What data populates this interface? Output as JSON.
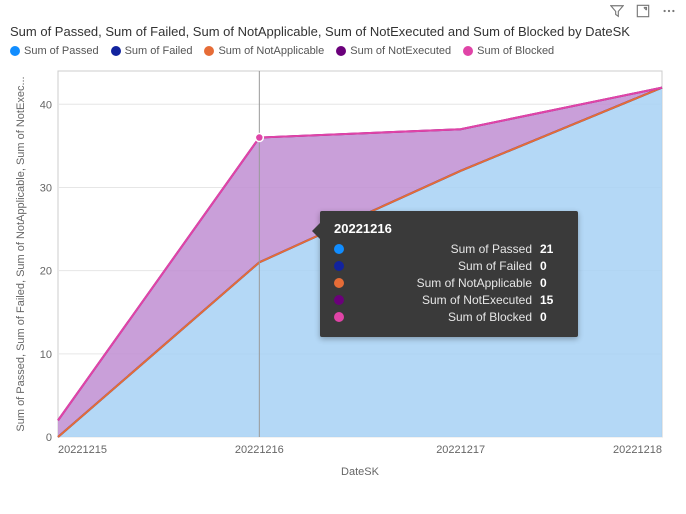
{
  "toolbar": {
    "filter_icon": "filter-icon",
    "focus_icon": "focus-mode-icon",
    "more_icon": "more-options-icon"
  },
  "title": "Sum of Passed, Sum of Failed, Sum of NotApplicable, Sum of NotExecuted and Sum of Blocked by DateSK",
  "legend": [
    {
      "label": "Sum of Passed",
      "color": "#118dff"
    },
    {
      "label": "Sum of Failed",
      "color": "#12239e"
    },
    {
      "label": "Sum of NotApplicable",
      "color": "#e66c37"
    },
    {
      "label": "Sum of NotExecuted",
      "color": "#6b007b"
    },
    {
      "label": "Sum of Blocked",
      "color": "#e044a7"
    }
  ],
  "tooltip": {
    "title": "20221216",
    "rows": [
      {
        "color": "#118dff",
        "name": "Sum of Passed",
        "value": "21"
      },
      {
        "color": "#12239e",
        "name": "Sum of Failed",
        "value": "0"
      },
      {
        "color": "#e66c37",
        "name": "Sum of NotApplicable",
        "value": "0"
      },
      {
        "color": "#6b007b",
        "name": "Sum of NotExecuted",
        "value": "15"
      },
      {
        "color": "#e044a7",
        "name": "Sum of Blocked",
        "value": "0"
      }
    ]
  },
  "chart_data": {
    "type": "area",
    "stacked": true,
    "title": "Sum of Passed, Sum of Failed, Sum of NotApplicable, Sum of NotExecuted and Sum of Blocked by DateSK",
    "xlabel": "DateSK",
    "ylabel": "Sum of Passed, Sum of Failed, Sum of NotApplicable, Sum of NotExec...",
    "categories": [
      "20221215",
      "20221216",
      "20221217",
      "20221218"
    ],
    "y_ticks": [
      0,
      10,
      20,
      30,
      40
    ],
    "ylim": [
      0,
      44
    ],
    "series": [
      {
        "name": "Sum of Passed",
        "color": "#118dff",
        "area_color": "#a7d1f5",
        "values": [
          0,
          21,
          32,
          42
        ]
      },
      {
        "name": "Sum of Failed",
        "color": "#12239e",
        "area_color": "#8a94d4",
        "values": [
          0,
          0,
          0,
          0
        ]
      },
      {
        "name": "Sum of NotApplicable",
        "color": "#e66c37",
        "area_color": "#f2b89a",
        "values": [
          0,
          0,
          0,
          0
        ]
      },
      {
        "name": "Sum of NotExecuted",
        "color": "#6b007b",
        "area_color": "#c08ed2",
        "values": [
          2,
          15,
          5,
          0
        ]
      },
      {
        "name": "Sum of Blocked",
        "color": "#e044a7",
        "area_color": "#efa3d3",
        "values": [
          0,
          0,
          0,
          0
        ]
      }
    ]
  }
}
